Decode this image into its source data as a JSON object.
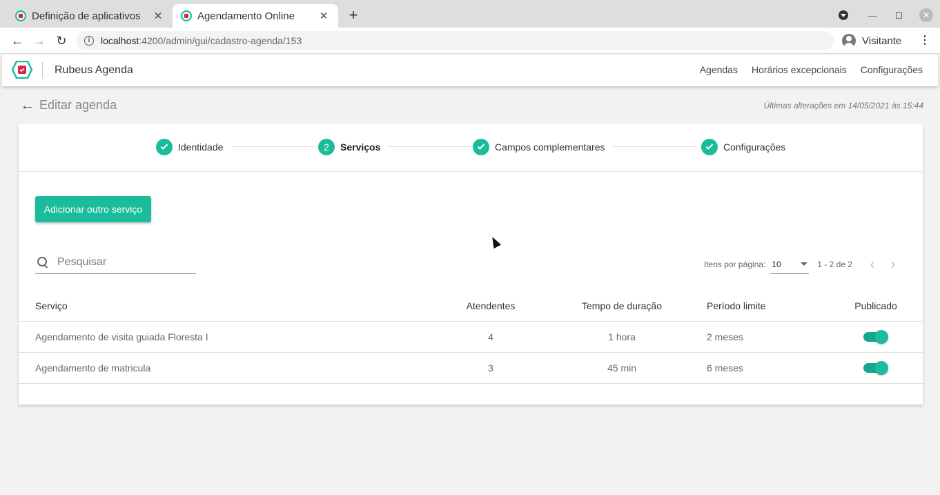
{
  "browser": {
    "tabs": [
      {
        "title": "Definição de aplicativos",
        "active": false
      },
      {
        "title": "Agendamento Online",
        "active": true
      }
    ],
    "tab_close_glyph": "✕",
    "new_tab_glyph": "+",
    "url_host": "localhost",
    "url_rest": ":4200/admin/gui/cadastro-agenda/153",
    "profile_name": "Visitante",
    "icons": {
      "back": "arrow-left-icon",
      "forward": "arrow-right-icon",
      "reload": "reload-icon",
      "info": "info-icon",
      "menu": "three-dots-icon"
    }
  },
  "app": {
    "name": "Rubeus Agenda",
    "nav": [
      "Agendas",
      "Horários excepcionais",
      "Configurações"
    ],
    "colors": {
      "accent": "#1abc9c",
      "logo_red": "#d6264d"
    }
  },
  "page": {
    "title": "Editar agenda",
    "last_changes": "Últimas alterações em 14/05/2021 às 15:44"
  },
  "stepper": {
    "steps": [
      {
        "label": "Identidade",
        "state": "done"
      },
      {
        "label": "Serviços",
        "state": "current",
        "number": "2"
      },
      {
        "label": "Campos complementares",
        "state": "done"
      },
      {
        "label": "Configurações",
        "state": "done"
      }
    ]
  },
  "actions": {
    "add_service": "Adicionar outro serviço"
  },
  "search": {
    "placeholder": "Pesquisar",
    "value": ""
  },
  "paginator": {
    "items_per_page_label": "Itens por página:",
    "page_size": "10",
    "range": "1 - 2 de 2"
  },
  "table": {
    "headers": [
      "Serviço",
      "Atendentes",
      "Tempo de duração",
      "Período limite",
      "Publicado"
    ],
    "rows": [
      {
        "service": "Agendamento de visita guiada Floresta I",
        "attendants": "4",
        "duration": "1 hora",
        "limit": "2 meses",
        "published": true
      },
      {
        "service": "Agendamento de matricula",
        "attendants": "3",
        "duration": "45 min",
        "limit": "6 meses",
        "published": true
      }
    ]
  }
}
